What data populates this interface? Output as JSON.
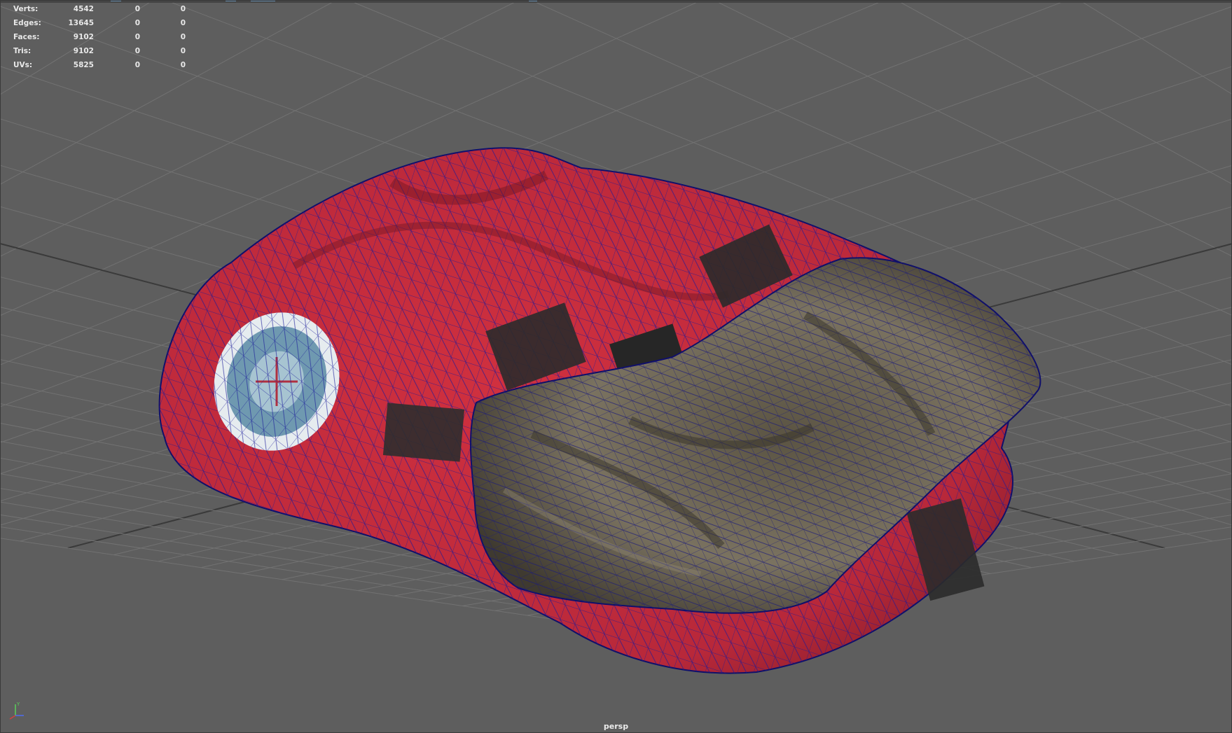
{
  "heads_up": {
    "rows": [
      {
        "label": "Verts:",
        "total": "4542",
        "selected": "0",
        "selected_obj": "0"
      },
      {
        "label": "Edges:",
        "total": "13645",
        "selected": "0",
        "selected_obj": "0"
      },
      {
        "label": "Faces:",
        "total": "9102",
        "selected": "0",
        "selected_obj": "0"
      },
      {
        "label": "Tris:",
        "total": "9102",
        "selected": "0",
        "selected_obj": "0"
      },
      {
        "label": "UVs:",
        "total": "5825",
        "selected": "0",
        "selected_obj": "0"
      }
    ]
  },
  "viewport": {
    "camera": "persp",
    "background_color": "#5e5e5e",
    "grid_color": "#727272",
    "grid_axis_color": "#3a3a3a",
    "wireframe_color": "#1a1a9a"
  },
  "model": {
    "jacket_color": "#c2283a",
    "fur_color": "#6f6754",
    "patch_color": "#6f99b0",
    "strap_color": "#2b2b2b"
  },
  "axis_gizmo": {
    "x_color": "#d24040",
    "y_color": "#5ad05a",
    "z_color": "#4f6cf0",
    "y_label": "Y"
  }
}
